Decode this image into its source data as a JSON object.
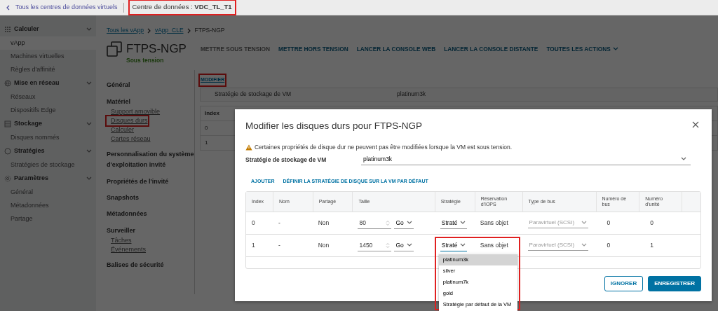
{
  "topbar": {
    "back_link": "Tous les centres de données virtuels",
    "datacenter_label": "Centre de données :",
    "datacenter": "VDC_TL_T1",
    "highlighted": true
  },
  "sidebar": {
    "groups": [
      {
        "label": "Calculer",
        "expanded": true,
        "items": [
          {
            "label": "vApp",
            "selected": true
          },
          {
            "label": "Machines virtuelles",
            "selected": false
          },
          {
            "label": "Règles d'affinité",
            "selected": false
          }
        ]
      },
      {
        "label": "Mise en réseau",
        "expanded": true,
        "items": [
          {
            "label": "Réseaux",
            "selected": false
          },
          {
            "label": "Dispositifs Edge",
            "selected": false
          }
        ]
      },
      {
        "label": "Stockage",
        "expanded": true,
        "items": [
          {
            "label": "Disques nommés",
            "selected": false
          }
        ]
      },
      {
        "label": "Stratégies",
        "expanded": true,
        "items": [
          {
            "label": "Stratégies de stockage",
            "selected": false
          }
        ]
      },
      {
        "label": "Paramètres",
        "expanded": true,
        "items": [
          {
            "label": "Général",
            "selected": false
          },
          {
            "label": "Métadonnées",
            "selected": false
          },
          {
            "label": "Partage",
            "selected": false
          }
        ]
      }
    ]
  },
  "breadcrumb": [
    {
      "label": "Tous les vApp",
      "link": true
    },
    {
      "label": "vApp_CLE",
      "link": true
    },
    {
      "label": "FTPS-NGP",
      "link": false
    }
  ],
  "vm": {
    "name": "FTPS-NGP",
    "status": "Sous tension"
  },
  "actions": [
    {
      "label": "METTRE SOUS TENSION",
      "disabled": true,
      "dropdown": false
    },
    {
      "label": "METTRE HORS TENSION",
      "disabled": false,
      "dropdown": false
    },
    {
      "label": "LANCER LA CONSOLE WEB",
      "disabled": false,
      "dropdown": false
    },
    {
      "label": "LANCER LA CONSOLE DISTANTE",
      "disabled": false,
      "dropdown": false
    },
    {
      "label": "TOUTES LES ACTIONS",
      "disabled": false,
      "dropdown": true
    }
  ],
  "sections": [
    {
      "label": "Général"
    },
    {
      "label": "Matériel",
      "children": [
        {
          "label": "Support amovible",
          "highlighted": false
        },
        {
          "label": "Disques durs",
          "highlighted": true
        },
        {
          "label": "Calculer",
          "highlighted": false
        },
        {
          "label": "Cartes réseau",
          "highlighted": false
        }
      ]
    },
    {
      "label": "Personnalisation du système d'exploitation invité"
    },
    {
      "label": "Propriétés de l'invité"
    },
    {
      "label": "Snapshots"
    },
    {
      "label": "Métadonnées"
    },
    {
      "label": "Surveiller",
      "children": [
        {
          "label": "Tâches",
          "highlighted": false
        },
        {
          "label": "Événements",
          "highlighted": false
        }
      ]
    },
    {
      "label": "Balises de sécurité"
    }
  ],
  "content": {
    "edit_link": "MODIFIER",
    "highlighted": true,
    "storage_label": "Stratégie de stockage de VM",
    "storage_value": "platinum3k",
    "table": {
      "columns": [
        "Index"
      ],
      "rows": [
        [
          "0"
        ],
        [
          "1"
        ]
      ]
    }
  },
  "modal": {
    "title": "Modifier les disques durs pour FTPS-NGP",
    "warning": "Certaines propriétés de disque dur ne peuvent pas être modifiées lorsque la VM est sous tension.",
    "storage_label": "Stratégie de stockage de VM",
    "storage_value": "platinum3k",
    "links": [
      "AJOUTER",
      "DÉFINIR LA STRATÉGIE DE DISQUE SUR LA VM PAR DÉFAUT"
    ],
    "columns": [
      "Index",
      "Nom",
      "Partagé",
      "Taille",
      "Stratégie",
      "Réservation d'IOPS",
      "Type de bus",
      "Numéro de bus",
      "Numéro d'unité"
    ],
    "disks": [
      {
        "index": "0",
        "name": "-",
        "shared": "Non",
        "size": "80",
        "unit": "Go",
        "policy": "Straté",
        "policy_open": false,
        "highlighted": false,
        "iops": "Sans objet",
        "bus_type": "Paravirtuel (SCSI)",
        "bus_number": "0",
        "unit_number": "0"
      },
      {
        "index": "1",
        "name": "-",
        "shared": "Non",
        "size": "1450",
        "unit": "Go",
        "policy": "Straté",
        "policy_open": true,
        "highlighted": true,
        "iops": "Sans objet",
        "bus_type": "Paravirtuel (SCSI)",
        "bus_number": "0",
        "unit_number": "1"
      }
    ],
    "policy_options": [
      {
        "label": "platinum3k",
        "selected": true
      },
      {
        "label": "silver",
        "selected": false
      },
      {
        "label": "platinum7k",
        "selected": false
      },
      {
        "label": "gold",
        "selected": false
      },
      {
        "label": "Stratégie par défaut de la VM",
        "selected": false
      }
    ],
    "buttons": [
      {
        "label": "IGNORER",
        "kind": "secondary"
      },
      {
        "label": "ENREGISTRER",
        "kind": "primary"
      }
    ]
  }
}
